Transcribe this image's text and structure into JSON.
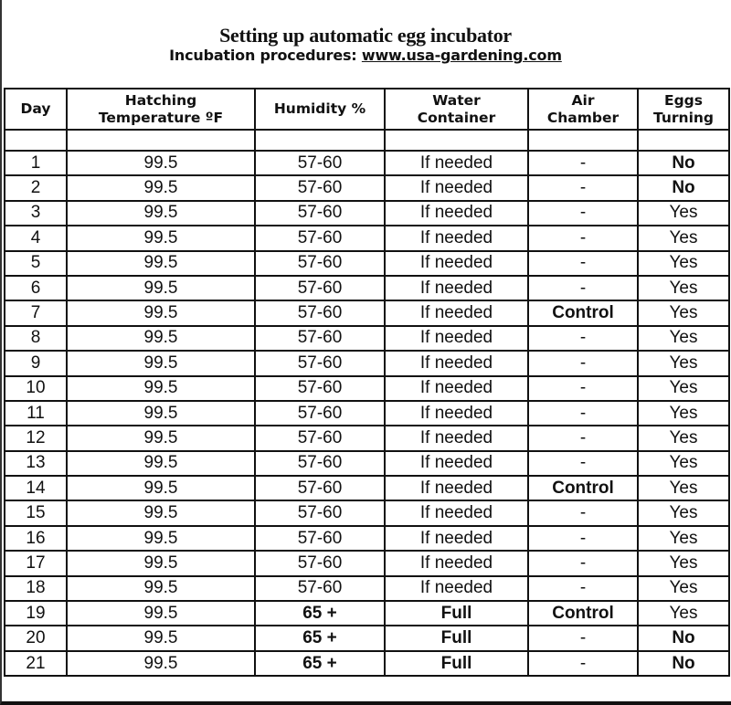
{
  "header": {
    "title": "Setting up automatic egg incubator",
    "subtitle_prefix": "Incubation procedures: ",
    "subtitle_link": "www.usa-gardening.com"
  },
  "table": {
    "columns": [
      {
        "line1": "Day",
        "line2": ""
      },
      {
        "line1": "Hatching",
        "line2": "Temperature ºF"
      },
      {
        "line1": "Humidity %",
        "line2": ""
      },
      {
        "line1": "Water",
        "line2": "Container"
      },
      {
        "line1": "Air",
        "line2": "Chamber"
      },
      {
        "line1": "Eggs",
        "line2": "Turning"
      }
    ],
    "rows": [
      {
        "day": "1",
        "temp": "99.5",
        "humidity": "57-60",
        "water": "If needed",
        "air": "-",
        "turning": "No"
      },
      {
        "day": "2",
        "temp": "99.5",
        "humidity": "57-60",
        "water": "If needed",
        "air": "-",
        "turning": "No"
      },
      {
        "day": "3",
        "temp": "99.5",
        "humidity": "57-60",
        "water": "If needed",
        "air": "-",
        "turning": "Yes"
      },
      {
        "day": "4",
        "temp": "99.5",
        "humidity": "57-60",
        "water": "If needed",
        "air": "-",
        "turning": "Yes"
      },
      {
        "day": "5",
        "temp": "99.5",
        "humidity": "57-60",
        "water": "If needed",
        "air": "-",
        "turning": "Yes"
      },
      {
        "day": "6",
        "temp": "99.5",
        "humidity": "57-60",
        "water": "If needed",
        "air": "-",
        "turning": "Yes"
      },
      {
        "day": "7",
        "temp": "99.5",
        "humidity": "57-60",
        "water": "If needed",
        "air": "Control",
        "turning": "Yes"
      },
      {
        "day": "8",
        "temp": "99.5",
        "humidity": "57-60",
        "water": "If needed",
        "air": "-",
        "turning": "Yes"
      },
      {
        "day": "9",
        "temp": "99.5",
        "humidity": "57-60",
        "water": "If needed",
        "air": "-",
        "turning": "Yes"
      },
      {
        "day": "10",
        "temp": "99.5",
        "humidity": "57-60",
        "water": "If needed",
        "air": "-",
        "turning": "Yes"
      },
      {
        "day": "11",
        "temp": "99.5",
        "humidity": "57-60",
        "water": "If needed",
        "air": "-",
        "turning": "Yes"
      },
      {
        "day": "12",
        "temp": "99.5",
        "humidity": "57-60",
        "water": "If needed",
        "air": "-",
        "turning": "Yes"
      },
      {
        "day": "13",
        "temp": "99.5",
        "humidity": "57-60",
        "water": "If needed",
        "air": "-",
        "turning": "Yes"
      },
      {
        "day": "14",
        "temp": "99.5",
        "humidity": "57-60",
        "water": "If needed",
        "air": "Control",
        "turning": "Yes"
      },
      {
        "day": "15",
        "temp": "99.5",
        "humidity": "57-60",
        "water": "If needed",
        "air": "-",
        "turning": "Yes"
      },
      {
        "day": "16",
        "temp": "99.5",
        "humidity": "57-60",
        "water": "If needed",
        "air": "-",
        "turning": "Yes"
      },
      {
        "day": "17",
        "temp": "99.5",
        "humidity": "57-60",
        "water": "If needed",
        "air": "-",
        "turning": "Yes"
      },
      {
        "day": "18",
        "temp": "99.5",
        "humidity": "57-60",
        "water": "If needed",
        "air": "-",
        "turning": "Yes"
      },
      {
        "day": "19",
        "temp": "99.5",
        "humidity": "65 +",
        "water": "Full",
        "air": "Control",
        "turning": "Yes"
      },
      {
        "day": "20",
        "temp": "99.5",
        "humidity": "65 +",
        "water": "Full",
        "air": "-",
        "turning": "No"
      },
      {
        "day": "21",
        "temp": "99.5",
        "humidity": "65 +",
        "water": "Full",
        "air": "-",
        "turning": "No"
      }
    ]
  }
}
